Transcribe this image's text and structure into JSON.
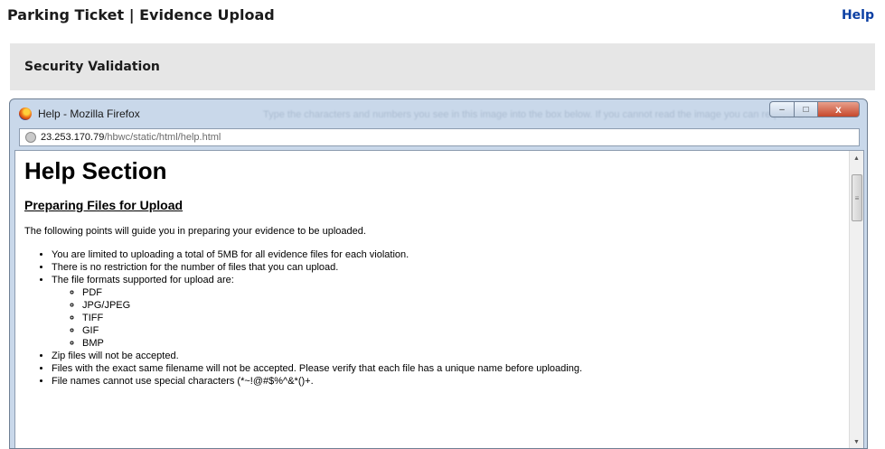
{
  "header": {
    "title": "Parking Ticket | Evidence Upload",
    "help_link": "Help"
  },
  "security": {
    "title": "Security Validation"
  },
  "popup": {
    "window_title": "Help - Mozilla Firefox",
    "background_text": "Type the characters and numbers you see in this image into the box below. If you cannot read the image you can request a new",
    "controls": {
      "minimize": "–",
      "maximize": "□",
      "close": "x"
    },
    "address": {
      "host": "23.253.170.79",
      "path": "/hbwc/static/html/help.html"
    }
  },
  "help": {
    "heading": "Help Section",
    "subheading": "Preparing Files for Upload",
    "intro": "The following points will guide you in preparing your evidence to be uploaded.",
    "points": [
      "You are limited to uploading a total of 5MB for all evidence files for each violation.",
      "There is no restriction for the number of files that you can upload.",
      "The file formats supported for upload are:"
    ],
    "formats": [
      "PDF",
      "JPG/JPEG",
      "TIFF",
      "GIF",
      "BMP"
    ],
    "points_after": [
      "Zip files will not be accepted.",
      "Files with the exact same filename will not be accepted. Please verify that each file has a unique name before uploading.",
      "File names cannot use special characters (*~!@#$%^&*()+."
    ]
  }
}
